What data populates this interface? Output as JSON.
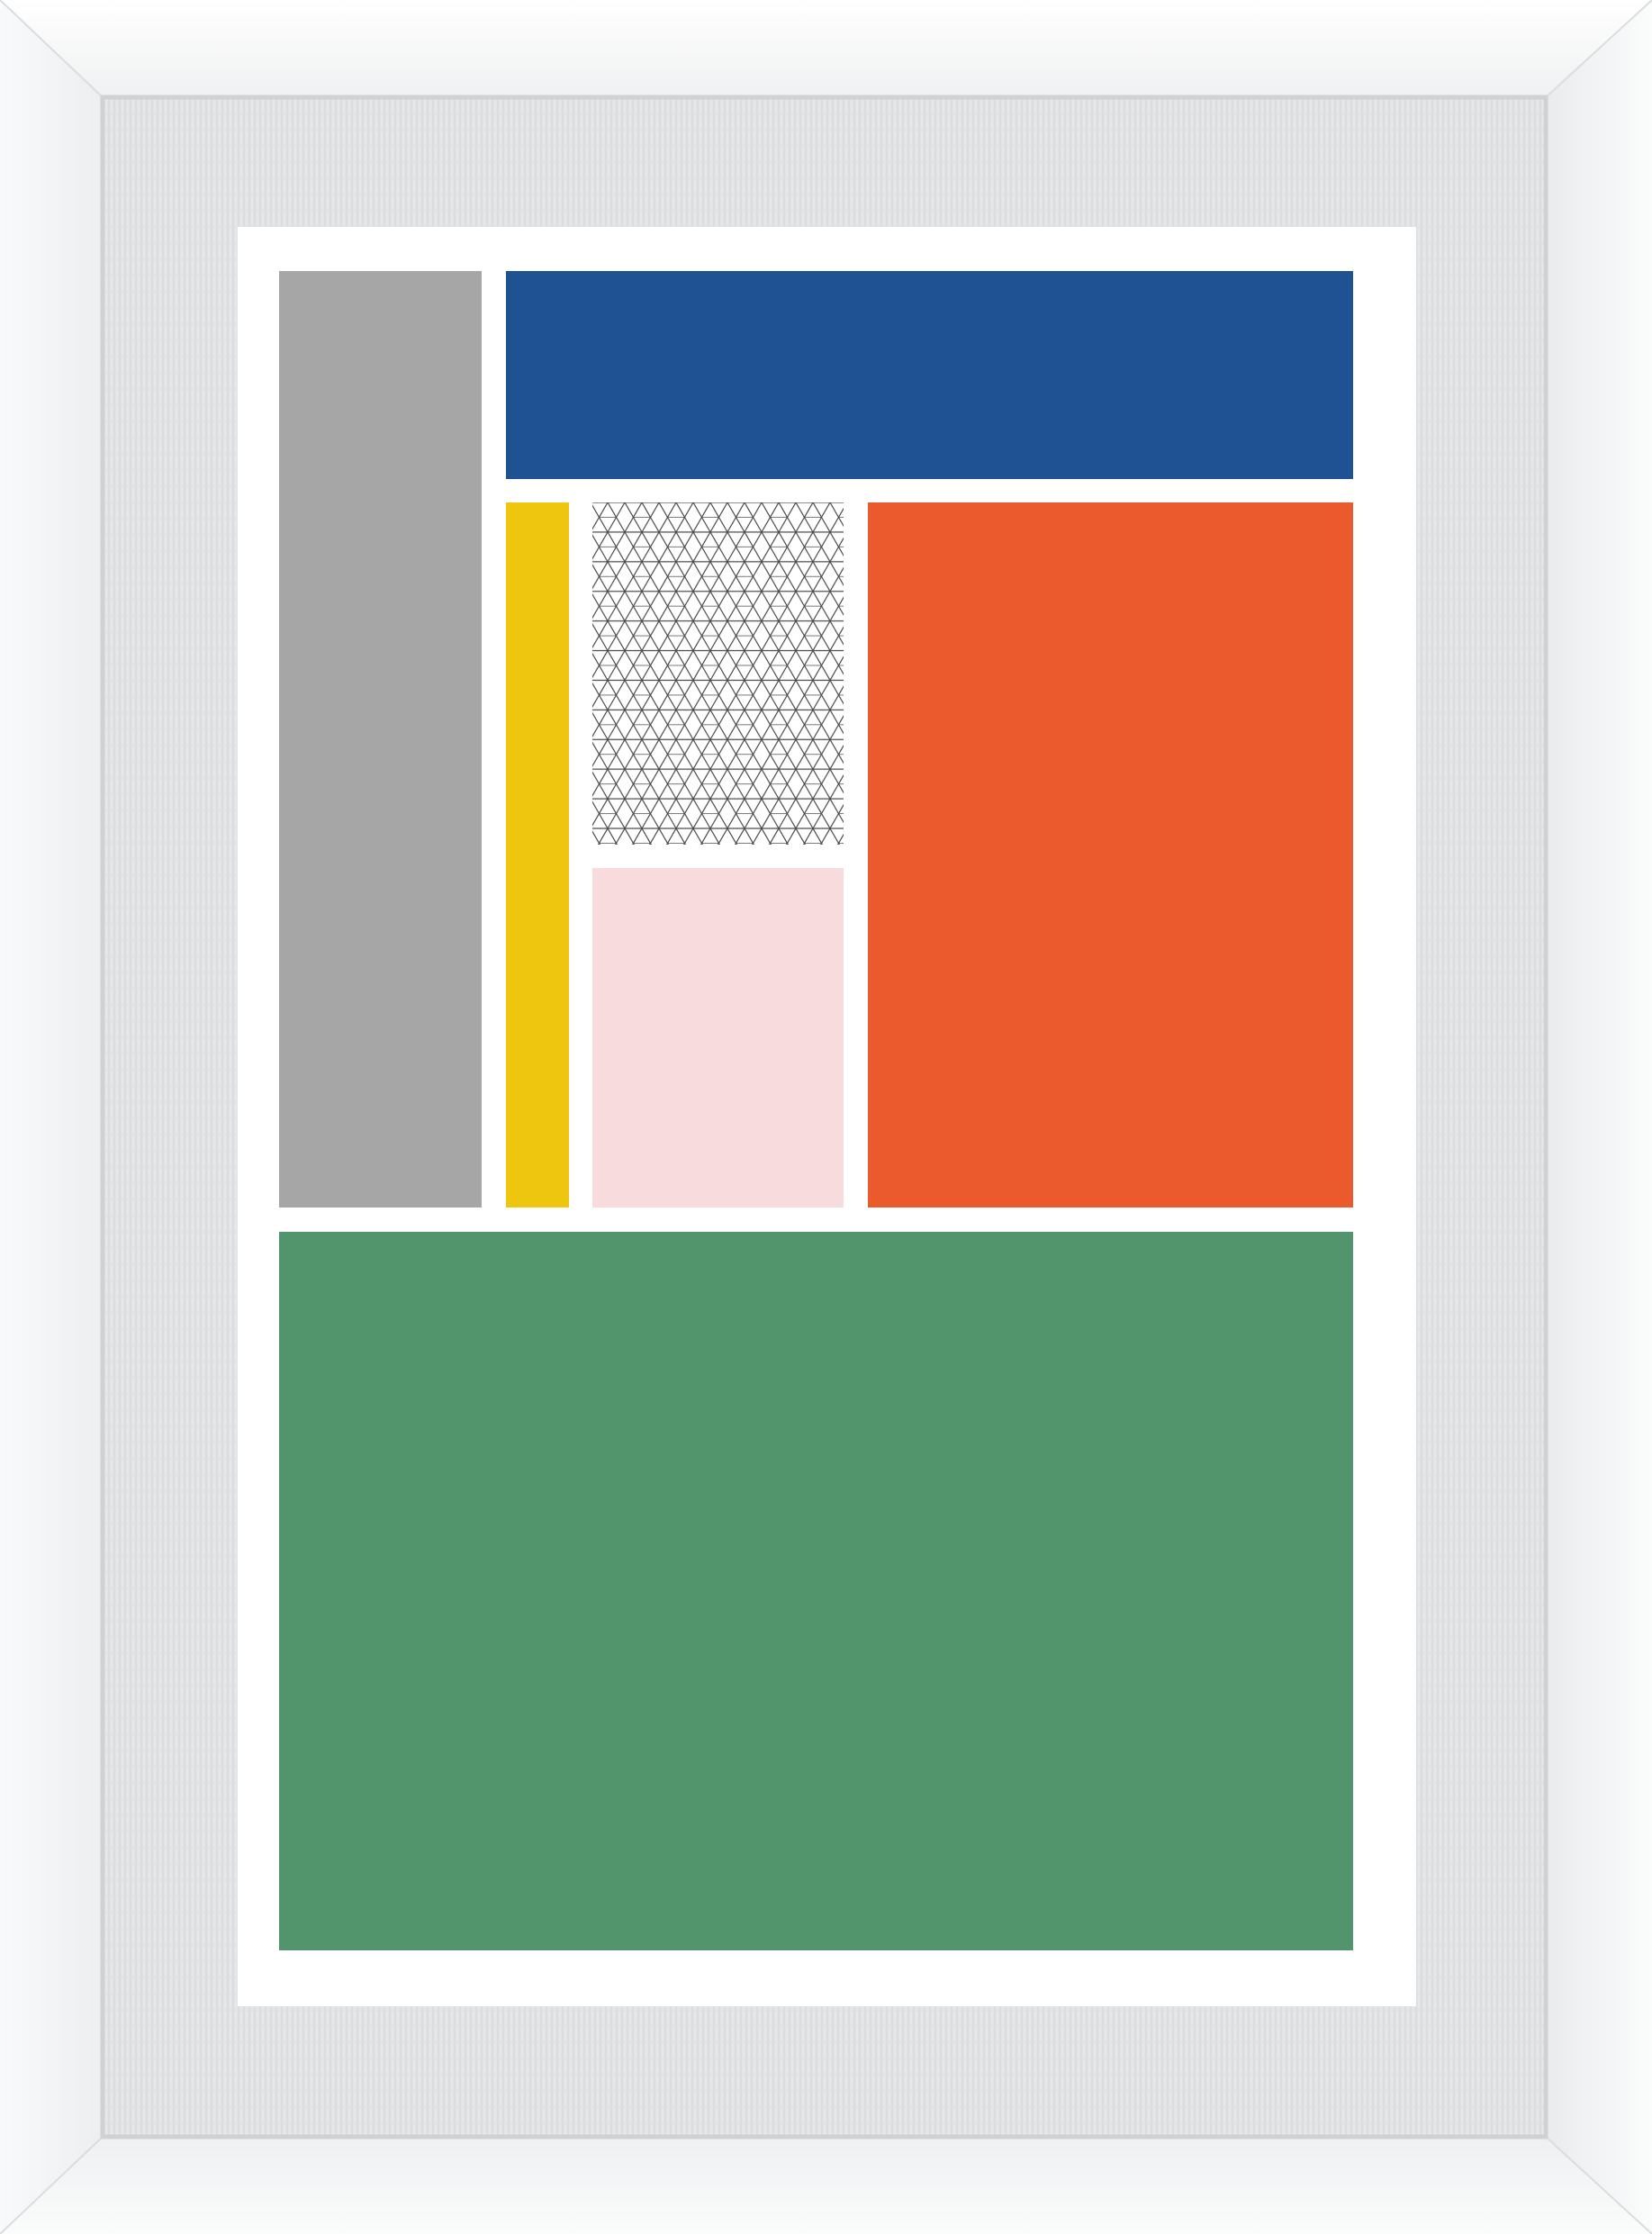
{
  "colors": {
    "frame": "#f3f4f5",
    "frame_shadow": "#dfe1e3",
    "mat": "#e2e3e4",
    "mat_texture": "#cfd1d3",
    "print_paper": "#ffffff",
    "gray_block": "#a6a6a6",
    "blue_block": "#1f5292",
    "yellow_block": "#eec610",
    "pattern_background": "#ffffff",
    "pattern_lines": "#4d4d4d",
    "pink_block": "#f8dcdd",
    "orange_block": "#ea5a2d",
    "green_block": "#52946b"
  },
  "artwork": {
    "blocks": [
      {
        "name": "gray-block",
        "color_key": "gray_block"
      },
      {
        "name": "blue-block",
        "color_key": "blue_block"
      },
      {
        "name": "yellow-block",
        "color_key": "yellow_block"
      },
      {
        "name": "pattern-block",
        "color_key": "pattern_background",
        "pattern": "triangular-lattice"
      },
      {
        "name": "pink-block",
        "color_key": "pink_block"
      },
      {
        "name": "orange-block",
        "color_key": "orange_block"
      },
      {
        "name": "green-block",
        "color_key": "green_block"
      }
    ]
  }
}
